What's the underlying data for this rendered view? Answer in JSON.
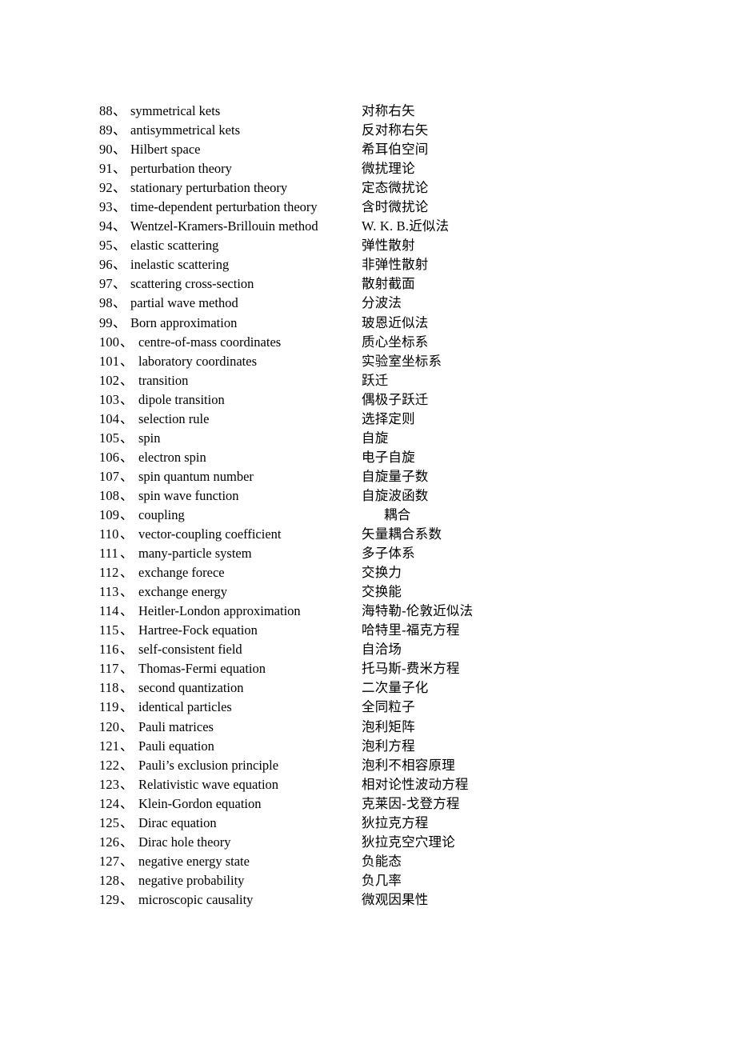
{
  "document": {
    "type": "bilingual-glossary",
    "subject": "quantum mechanics terminology",
    "separator": "、",
    "background_color": "#ffffff",
    "text_color": "#000000"
  },
  "entries": [
    {
      "number": "88",
      "term": "symmetrical kets",
      "translation": "对称右矢"
    },
    {
      "number": "89",
      "term": "antisymmetrical kets",
      "translation": "反对称右矢"
    },
    {
      "number": "90",
      "term": "Hilbert space",
      "translation": "希耳伯空间"
    },
    {
      "number": "91",
      "term": "perturbation theory",
      "translation": "微扰理论"
    },
    {
      "number": "92",
      "term": "stationary perturbation theory",
      "translation": "定态微扰论"
    },
    {
      "number": "93",
      "term": "time-dependent perturbation theory",
      "translation": "含时微扰论"
    },
    {
      "number": "94",
      "term": "Wentzel-Kramers-Brillouin method",
      "translation": "W. K. B.近似法"
    },
    {
      "number": "95",
      "term": "elastic scattering",
      "translation": "弹性散射"
    },
    {
      "number": "96",
      "term": "inelastic scattering",
      "translation": "非弹性散射"
    },
    {
      "number": "97",
      "term": "scattering cross-section",
      "translation": "散射截面"
    },
    {
      "number": "98",
      "term": "partial wave method",
      "translation": "分波法"
    },
    {
      "number": "99",
      "term": "Born approximation",
      "translation": "玻恩近似法"
    },
    {
      "number": "100",
      "term": "centre-of-mass coordinates",
      "translation": "质心坐标系"
    },
    {
      "number": "101",
      "term": "laboratory coordinates",
      "translation": "实验室坐标系"
    },
    {
      "number": "102",
      "term": "transition",
      "translation": "跃迁"
    },
    {
      "number": "103",
      "term": "dipole transition",
      "translation": "偶极子跃迁"
    },
    {
      "number": "104",
      "term": "selection rule",
      "translation": "选择定则"
    },
    {
      "number": "105",
      "term": "spin",
      "translation": "自旋"
    },
    {
      "number": "106",
      "term": "electron spin",
      "translation": "电子自旋"
    },
    {
      "number": "107",
      "term": "spin quantum number",
      "translation": "自旋量子数"
    },
    {
      "number": "108",
      "term": "spin wave function",
      "translation": "自旋波函数"
    },
    {
      "number": "109",
      "term": "coupling",
      "translation": "耦合",
      "translation_indented": true
    },
    {
      "number": "110",
      "term": "vector-coupling coefficient",
      "translation": "矢量耦合系数"
    },
    {
      "number": "111",
      "term": "many-particle system",
      "translation": "多子体系"
    },
    {
      "number": "112",
      "term": "exchange forece",
      "translation": "交换力"
    },
    {
      "number": "113",
      "term": "exchange energy",
      "translation": "交换能"
    },
    {
      "number": "114",
      "term": "Heitler-London approximation",
      "translation": "海特勒-伦敦近似法"
    },
    {
      "number": "115",
      "term": "Hartree-Fock equation",
      "translation": "哈特里-福克方程"
    },
    {
      "number": "116",
      "term": "self-consistent field",
      "translation": "自洽场"
    },
    {
      "number": "117",
      "term": "Thomas-Fermi equation",
      "translation": "托马斯-费米方程"
    },
    {
      "number": "118",
      "term": "second quantization",
      "translation": "二次量子化"
    },
    {
      "number": "119",
      "term": "identical particles",
      "translation": "全同粒子"
    },
    {
      "number": "120",
      "term": "Pauli matrices",
      "translation": "泡利矩阵"
    },
    {
      "number": "121",
      "term": "Pauli equation",
      "translation": "泡利方程"
    },
    {
      "number": "122",
      "term": "Pauli’s exclusion principle",
      "translation": "泡利不相容原理"
    },
    {
      "number": "123",
      "term": "Relativistic wave equation",
      "translation": "相对论性波动方程"
    },
    {
      "number": "124",
      "term": "Klein-Gordon equation",
      "translation": "克莱因-戈登方程"
    },
    {
      "number": "125",
      "term": "Dirac equation",
      "translation": "狄拉克方程"
    },
    {
      "number": "126",
      "term": "Dirac hole theory",
      "translation": "狄拉克空穴理论"
    },
    {
      "number": "127",
      "term": "negative energy state",
      "translation": "负能态"
    },
    {
      "number": "128",
      "term": "negative probability",
      "translation": "负几率"
    },
    {
      "number": "129",
      "term": "microscopic causality",
      "translation": "微观因果性"
    }
  ]
}
